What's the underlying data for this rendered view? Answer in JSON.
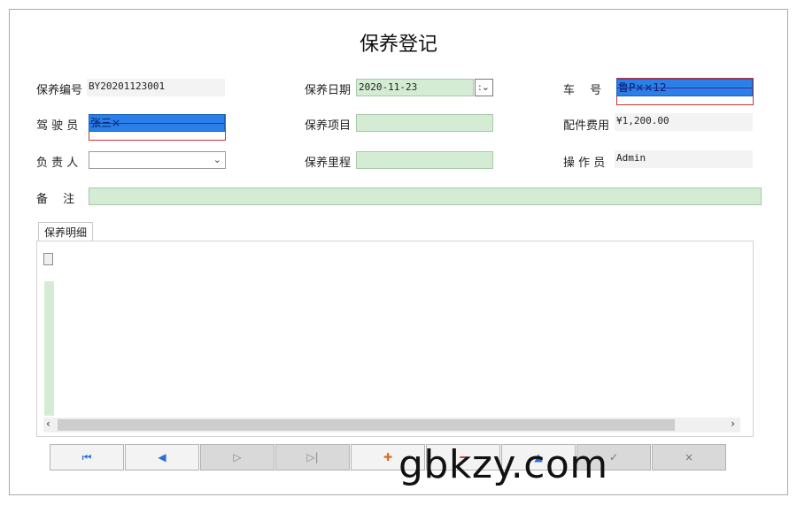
{
  "title": "保养登记",
  "fields": {
    "maint_no": {
      "label": "保养编号",
      "value": "BY20201123001"
    },
    "maint_date": {
      "label": "保养日期",
      "value": "2020-11-23"
    },
    "plate": {
      "label": "车　 号",
      "value": "鲁P××12"
    },
    "driver": {
      "label": "驾 驶 员",
      "value": "张三×"
    },
    "maint_item": {
      "label": "保养项目",
      "value": ""
    },
    "parts_cost": {
      "label": "配件费用",
      "value": "¥1,200.00"
    },
    "responsible": {
      "label": "负 责 人",
      "value": ""
    },
    "mileage": {
      "label": "保养里程",
      "value": ""
    },
    "operator": {
      "label": "操 作 员",
      "value": "Admin"
    },
    "remarks": {
      "label": "备　 注",
      "value": ""
    }
  },
  "tab": {
    "label": "保养明细"
  },
  "scroll": {
    "left": "‹",
    "right": "›"
  },
  "nav": {
    "first": "⏮",
    "prev": "◀",
    "next": "▷",
    "last": "▷|",
    "add": "✚",
    "delete": "━",
    "edit": "▲",
    "save": "✓",
    "cancel": "×"
  },
  "colors": {
    "accent": "#2a7fe8",
    "input_green": "#d4ecd4",
    "add_orange": "#e06a1a"
  },
  "watermark": "gbkzy.com"
}
